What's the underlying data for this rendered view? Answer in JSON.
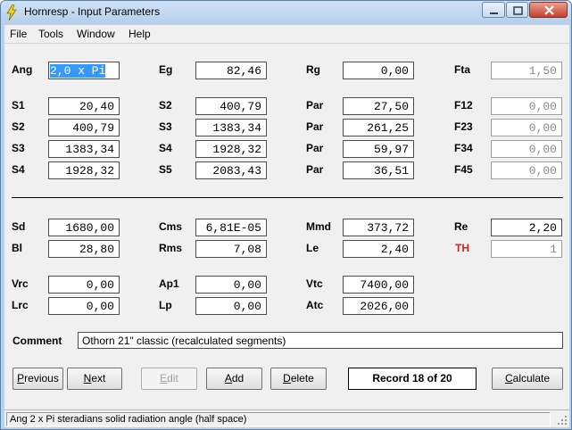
{
  "window": {
    "title": "Hornresp - Input Parameters"
  },
  "menu": [
    "File",
    "Tools",
    "Window",
    "Help"
  ],
  "params": {
    "Ang": {
      "label": "Ang",
      "value": "2,0 x Pi"
    },
    "Eg": {
      "label": "Eg",
      "value": "82,46"
    },
    "Rg": {
      "label": "Rg",
      "value": "0,00"
    },
    "Fta": {
      "label": "Fta",
      "value": "1,50"
    },
    "S1": {
      "label": "S1",
      "value": "20,40"
    },
    "S2a": {
      "label": "S2",
      "value": "400,79"
    },
    "Par1": {
      "label": "Par",
      "value": "27,50"
    },
    "F12": {
      "label": "F12",
      "value": "0,00"
    },
    "S2b": {
      "label": "S2",
      "value": "400,79"
    },
    "S3a": {
      "label": "S3",
      "value": "1383,34"
    },
    "Par2": {
      "label": "Par",
      "value": "261,25"
    },
    "F23": {
      "label": "F23",
      "value": "0,00"
    },
    "S3b": {
      "label": "S3",
      "value": "1383,34"
    },
    "S4a": {
      "label": "S4",
      "value": "1928,32"
    },
    "Par3": {
      "label": "Par",
      "value": "59,97"
    },
    "F34": {
      "label": "F34",
      "value": "0,00"
    },
    "S4b": {
      "label": "S4",
      "value": "1928,32"
    },
    "S5": {
      "label": "S5",
      "value": "2083,43"
    },
    "Par4": {
      "label": "Par",
      "value": "36,51"
    },
    "F45": {
      "label": "F45",
      "value": "0,00"
    },
    "Sd": {
      "label": "Sd",
      "value": "1680,00"
    },
    "Cms": {
      "label": "Cms",
      "value": "6,81E-05"
    },
    "Mmd": {
      "label": "Mmd",
      "value": "373,72"
    },
    "Re": {
      "label": "Re",
      "value": "2,20"
    },
    "Bl": {
      "label": "Bl",
      "value": "28,80"
    },
    "Rms": {
      "label": "Rms",
      "value": "7,08"
    },
    "Le": {
      "label": "Le",
      "value": "2,40"
    },
    "TH": {
      "label": "TH",
      "value": "1"
    },
    "Vrc": {
      "label": "Vrc",
      "value": "0,00"
    },
    "Ap1": {
      "label": "Ap1",
      "value": "0,00"
    },
    "Vtc": {
      "label": "Vtc",
      "value": "7400,00"
    },
    "Lrc": {
      "label": "Lrc",
      "value": "0,00"
    },
    "Lp": {
      "label": "Lp",
      "value": "0,00"
    },
    "Atc": {
      "label": "Atc",
      "value": "2026,00"
    }
  },
  "comment": {
    "label": "Comment",
    "value": "Othorn 21\" classic (recalculated segments)"
  },
  "buttons": {
    "previous": {
      "mnemonic": "P",
      "rest": "revious"
    },
    "next": {
      "mnemonic": "N",
      "rest": "ext"
    },
    "edit": {
      "mnemonic": "E",
      "rest": "dit"
    },
    "add": {
      "mnemonic": "A",
      "rest": "dd"
    },
    "delete": {
      "mnemonic": "D",
      "rest": "elete"
    },
    "calculate": {
      "mnemonic": "C",
      "rest": "alculate"
    }
  },
  "record": "Record 18 of 20",
  "status": "Ang   2 x Pi steradians solid radiation angle  (half space)",
  "colors": {
    "title_bg": "#b8d2ec",
    "panel_bg": "#f0f0f0",
    "th_label": "#d81e1e",
    "selection": "#3399ff"
  }
}
